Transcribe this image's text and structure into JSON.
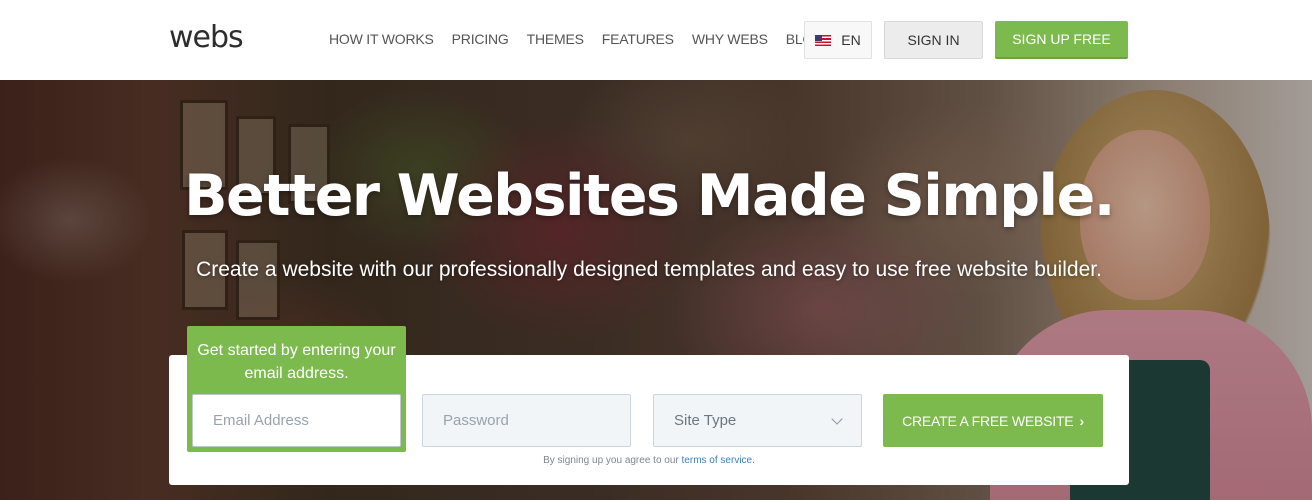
{
  "header": {
    "logo": "webs",
    "nav": [
      "HOW IT WORKS",
      "PRICING",
      "THEMES",
      "FEATURES",
      "WHY WEBS",
      "BLOG"
    ],
    "language": "EN",
    "sign_in": "SIGN IN",
    "sign_up": "SIGN UP FREE"
  },
  "hero": {
    "title": "Better Websites Made Simple.",
    "subtitle": "Create a website with our professionally designed templates and easy to use free website builder."
  },
  "form": {
    "get_started": "Get started by entering your email address.",
    "email_placeholder": "Email Address",
    "password_placeholder": "Password",
    "site_type": "Site Type",
    "submit": "CREATE A FREE WEBSITE",
    "submit_arrow": "›",
    "terms_prefix": "By signing up you agree to our",
    "terms_link": "terms of service",
    "terms_suffix": "."
  },
  "colors": {
    "brand_green": "#7cba4e",
    "text_dark": "#2d2d2d"
  }
}
